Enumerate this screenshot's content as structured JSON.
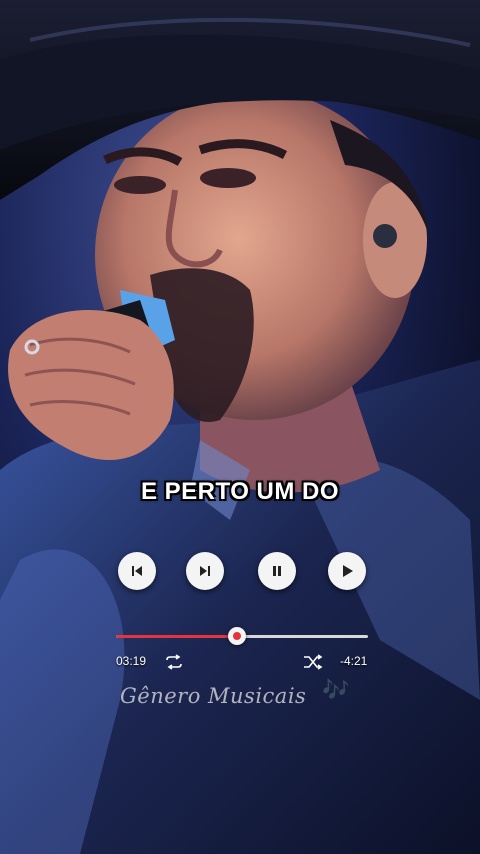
{
  "lyric": "E PERTO UM DO",
  "player": {
    "elapsed": "03:19",
    "remaining": "-4:21",
    "progress": 0.48,
    "controls": [
      "previous-track",
      "next-track",
      "pause",
      "play"
    ]
  },
  "watermark": "Gênero Musicais",
  "watermark_notes": "🎶",
  "colors": {
    "accent": "#e5343f",
    "track": "#d8d8d8",
    "button": "#f4f4f4"
  }
}
